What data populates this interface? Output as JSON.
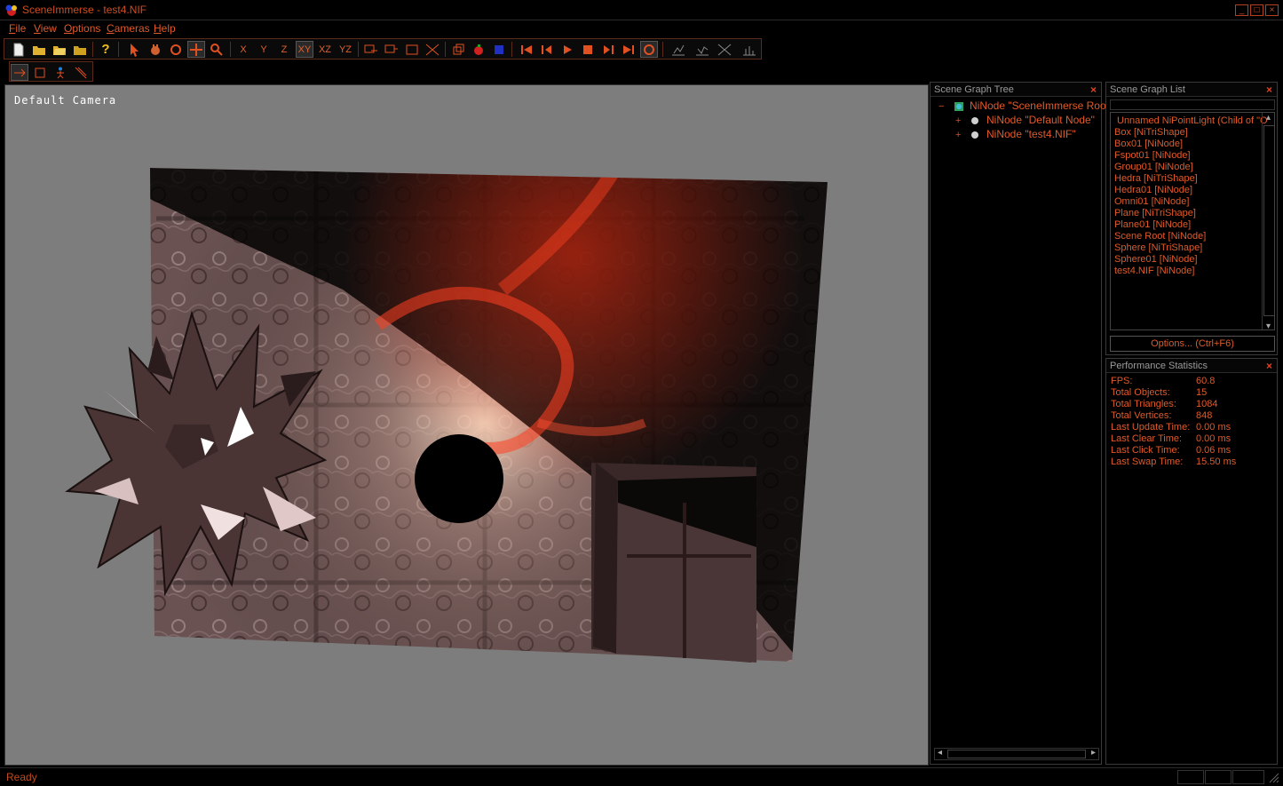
{
  "window": {
    "title": "SceneImmerse - test4.NIF",
    "controls": [
      "_",
      "□",
      "×"
    ]
  },
  "menu": [
    {
      "label": "File",
      "hotkey": "F",
      "rest": "ile"
    },
    {
      "label": "View",
      "hotkey": "V",
      "rest": "iew"
    },
    {
      "label": "Options",
      "hotkey": "O",
      "rest": "ptions"
    },
    {
      "label": "Cameras",
      "hotkey": "C",
      "rest": "ameras"
    },
    {
      "label": "Help",
      "hotkey": "H",
      "rest": "elp"
    }
  ],
  "toolbar": {
    "axis_labels": [
      "X",
      "Y",
      "Z",
      "XY",
      "XZ",
      "YZ"
    ],
    "icons": [
      "new-file-icon",
      "open-file-icon",
      "open-folder-icon",
      "open-recent-icon",
      "help-icon",
      "select-arrow-icon",
      "pan-hand-icon",
      "rotate-icon",
      "translate-icon",
      "zoom-icon",
      "tool-a-icon",
      "tool-b-icon",
      "tool-c-icon",
      "tool-d-icon",
      "cube-icon",
      "object-icon",
      "shaded-cube-icon",
      "skip-to-start-icon",
      "step-back-icon",
      "play-icon",
      "stop-icon",
      "step-forward-icon",
      "skip-to-end-icon",
      "loop-icon",
      "stats-a-icon",
      "stats-b-icon",
      "stats-c-icon",
      "stats-d-icon"
    ],
    "row2_icons": [
      "arrow-tool-icon",
      "frame-tool-icon",
      "walk-icon",
      "collision-icon"
    ]
  },
  "viewport": {
    "camera_label": "Default Camera"
  },
  "scene_graph_tree": {
    "title": "Scene Graph Tree",
    "close": "×",
    "nodes": [
      {
        "toggle": "−",
        "label": "NiNode \"SceneImmerse Root\""
      },
      {
        "toggle": "+",
        "label": "NiNode \"Default Node\""
      },
      {
        "toggle": "+",
        "label": "NiNode \"test4.NIF\""
      }
    ],
    "scroll_left": "◂",
    "scroll_right": "▸"
  },
  "scene_graph_list": {
    "title": "Scene Graph List",
    "close": "×",
    "items": [
      "Unnamed NiPointLight (Child of \"O",
      "Box [NiTriShape]",
      "Box01 [NiNode]",
      "Fspot01 [NiNode]",
      "Group01 [NiNode]",
      "Hedra [NiTriShape]",
      "Hedra01 [NiNode]",
      "Omni01 [NiNode]",
      "Plane [NiTriShape]",
      "Plane01 [NiNode]",
      "Scene Root [NiNode]",
      "Sphere [NiTriShape]",
      "Sphere01 [NiNode]",
      "test4.NIF [NiNode]"
    ],
    "options_button": "Options... (Ctrl+F6)",
    "scroll_up": "▴",
    "scroll_down": "▾"
  },
  "performance_statistics": {
    "title": "Performance Statistics",
    "close": "×",
    "rows": [
      {
        "label": "FPS:",
        "value": "60.8"
      },
      {
        "label": "Total Objects:",
        "value": "15"
      },
      {
        "label": "Total Triangles:",
        "value": "1084"
      },
      {
        "label": "Total Vertices:",
        "value": "848"
      },
      {
        "label": "Last Update Time:",
        "value": "0.00 ms"
      },
      {
        "label": "Last Clear Time:",
        "value": "0.00 ms"
      },
      {
        "label": "Last Click Time:",
        "value": "0.06 ms"
      },
      {
        "label": "Last Swap Time:",
        "value": "15.50 ms"
      }
    ]
  },
  "status": {
    "text": "Ready"
  },
  "colors": {
    "accent": "#e05a2a",
    "background": "#000000",
    "viewport_bg": "#7d7d7d"
  }
}
